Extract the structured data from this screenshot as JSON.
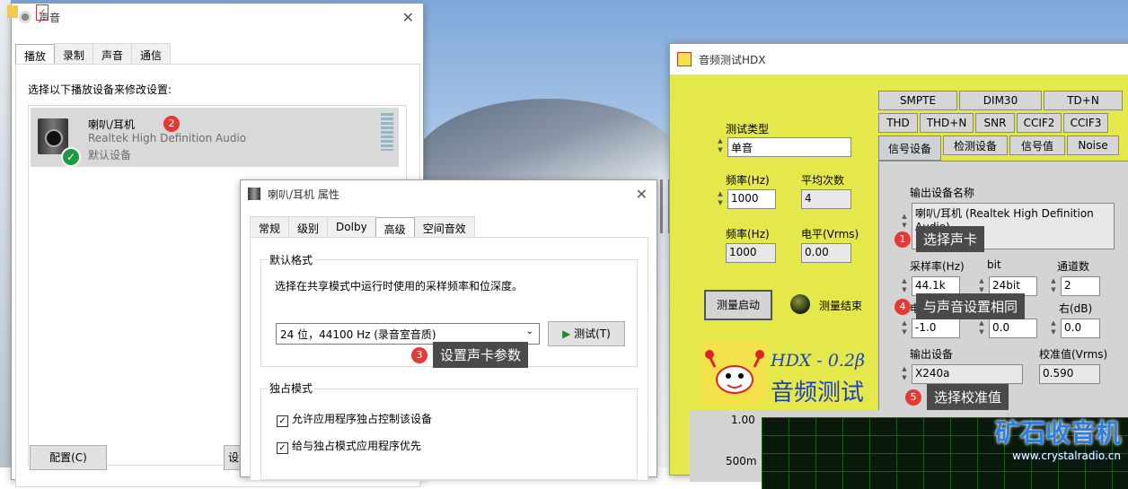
{
  "sound": {
    "title": "声音",
    "tabs": [
      "播放",
      "录制",
      "声音",
      "通信"
    ],
    "instruction": "选择以下播放设备来修改设置:",
    "device": {
      "name": "喇叭/耳机",
      "driver": "Realtek High Definition Audio",
      "status": "默认设备"
    },
    "configure_button": "配置(C)",
    "set_default_partial": "设"
  },
  "props": {
    "title": "喇叭/耳机 属性",
    "tabs": [
      "常规",
      "级别",
      "Dolby",
      "高级",
      "空间音效"
    ],
    "default_format_label": "默认格式",
    "default_format_desc": "选择在共享模式中运行时使用的采样频率和位深度。",
    "format_value": "24 位，44100 Hz (录音室音质)",
    "test_button": "测试(T)",
    "exclusive_label": "独占模式",
    "exclusive_options": [
      "允许应用程序独占控制该设备",
      "给与独占模式应用程序优先"
    ]
  },
  "hdx": {
    "title": "音频测试HDX",
    "test_type_label": "测试类型",
    "test_type_value": "单音",
    "freq_label": "频率(Hz)",
    "freq_value": "1000",
    "avg_label": "平均次数",
    "avg_value": "4",
    "freq2_label": "频率(Hz)",
    "freq2_value": "1000",
    "level_label": "电平(Vrms)",
    "level_value": "0.00",
    "measure_button": "测量启动",
    "measure_done": "测量结束",
    "logo_version": "HDX - 0.2β",
    "logo_title": "音频测试",
    "tabs_row1": [
      "SMPTE",
      "DIM30",
      "TD+N"
    ],
    "tabs_row2": [
      "THD",
      "THD+N",
      "SNR",
      "CCIF2",
      "CCIF3"
    ],
    "tabs_row3": [
      "信号设备",
      "检测设备",
      "信号值",
      "Noise"
    ],
    "out_dev_name_label": "输出设备名称",
    "out_dev_name_value": "喇叭/耳机 (Realtek High Definition Audio)",
    "samplerate_label": "采样率(Hz)",
    "samplerate_value": "44.1k",
    "bit_label": "bit",
    "bit_value": "24bit",
    "channels_label": "通道数",
    "channels_value": "2",
    "left_label": "电平",
    "left_value": "-1.0",
    "mid_value": "0.0",
    "right_label": "右(dB)",
    "right_value": "0.0",
    "out_dev_label": "输出设备",
    "out_dev_value": "X240a",
    "cal_label": "校准值(Vrms)",
    "cal_value": "0.590",
    "plot_y1": "1.00",
    "plot_y2": "500m"
  },
  "annotations": [
    {
      "num": "1",
      "text": "选择声卡"
    },
    {
      "num": "2",
      "text": ""
    },
    {
      "num": "3",
      "text": "设置声卡参数"
    },
    {
      "num": "4",
      "text": "与声音设置相同"
    },
    {
      "num": "5",
      "text": "选择校准值"
    }
  ],
  "watermark": {
    "line1": "矿石收音机",
    "line2": "www.crystalradio.cn"
  }
}
